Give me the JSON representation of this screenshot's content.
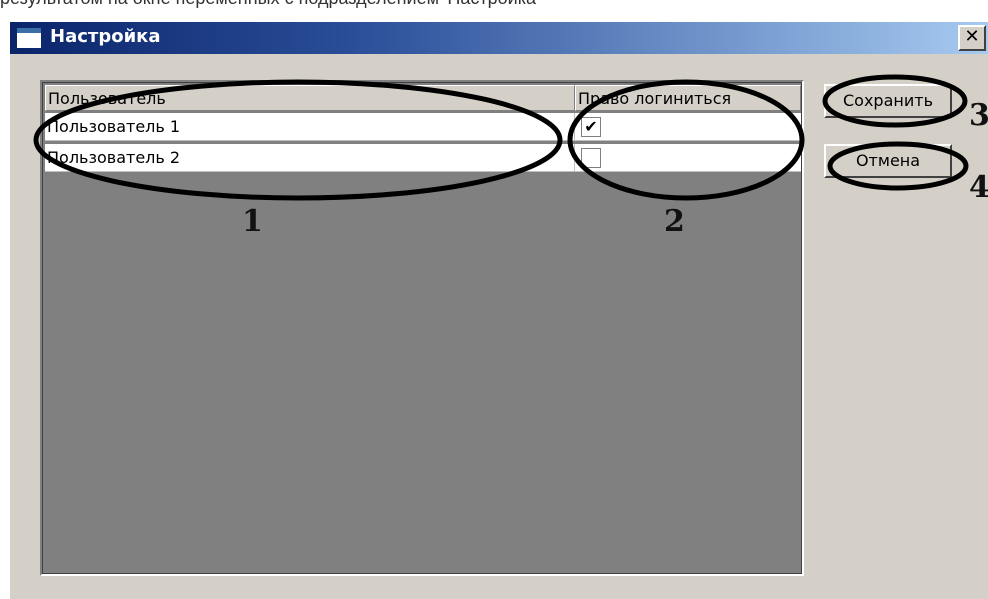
{
  "page_text_top": "результатом на окне переменных с подразделением 'Настройка'",
  "dialog": {
    "title": "Настройка",
    "close_glyph": "✕"
  },
  "table": {
    "columns": [
      "Пользователь",
      "Право логиниться"
    ],
    "rows": [
      {
        "user": "Пользователь 1",
        "can_login": true,
        "check_glyph": "✔"
      },
      {
        "user": "Пользователь 2",
        "can_login": false,
        "check_glyph": ""
      }
    ]
  },
  "buttons": {
    "save_label": "Сохранить",
    "cancel_label": "Отмена"
  },
  "annotations": {
    "n1": "1",
    "n2": "2",
    "n3": "3",
    "n4": "4"
  },
  "colors": {
    "title_gradient_start": "#0a246a",
    "title_gradient_end": "#a6caf0",
    "dialog_bg": "#d4d0c8",
    "table_empty_bg": "#808080"
  },
  "icons": {
    "window": "window-icon",
    "close": "close-icon",
    "checkbox_checked": "checkmark-icon"
  }
}
